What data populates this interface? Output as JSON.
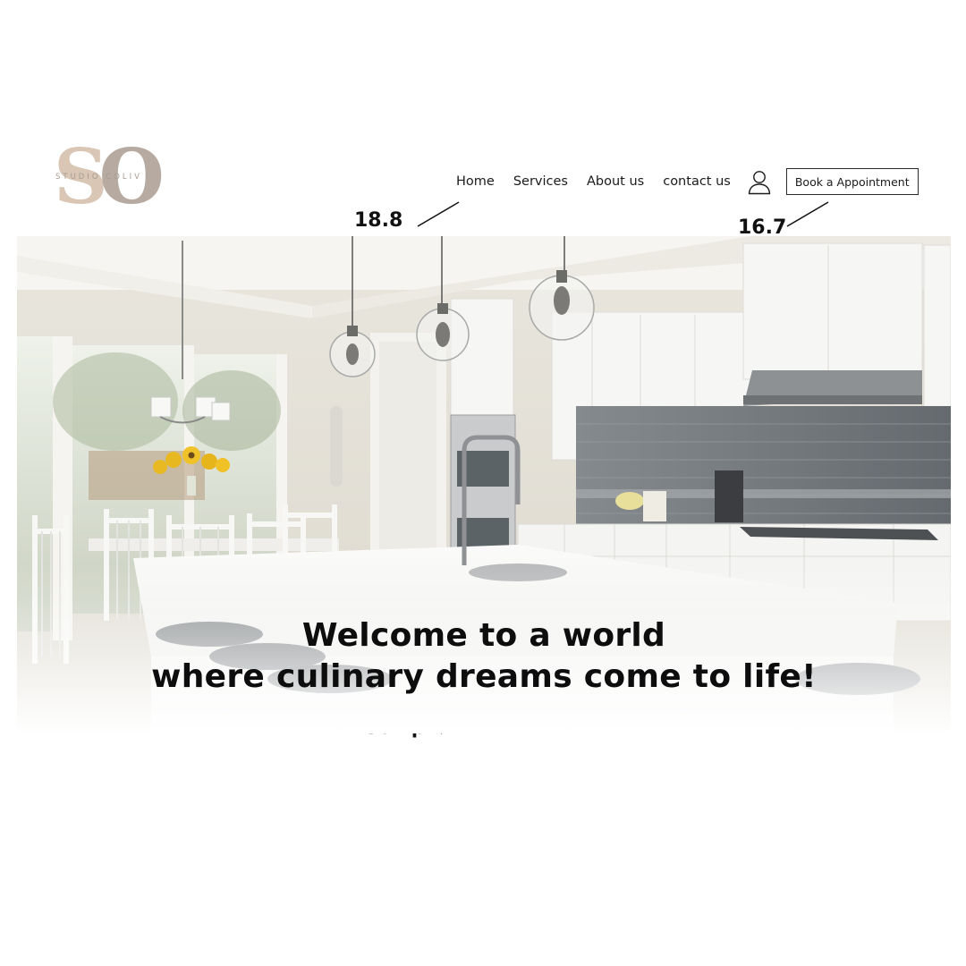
{
  "logo": {
    "letters": "SO",
    "subtitle": "STUDIO COLIV"
  },
  "nav": {
    "links": [
      {
        "label": "Home"
      },
      {
        "label": "Services"
      },
      {
        "label": "About us"
      },
      {
        "label": "contact us"
      }
    ],
    "user_icon": "user-icon",
    "book_button": "Book a Appointment"
  },
  "annotations": {
    "nav_font_size": "18.8",
    "button_font_size": "16.7",
    "headline_font_size": "56.2px"
  },
  "hero": {
    "headline_line1": "Welcome to a world",
    "headline_line2": "where culinary dreams come to life!"
  },
  "colors": {
    "logo_s": "#d9c6b5",
    "logo_o": "#b6aaa1",
    "text": "#1b1b1b",
    "backsplash": "#6f7479",
    "cabinet": "#f4f4f2"
  }
}
